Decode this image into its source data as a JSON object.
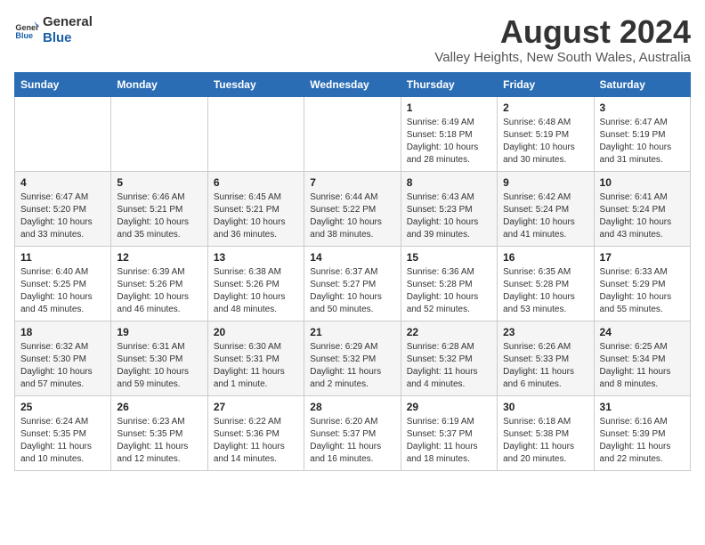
{
  "logo": {
    "line1": "General",
    "line2": "Blue"
  },
  "title": "August 2024",
  "subtitle": "Valley Heights, New South Wales, Australia",
  "days_of_week": [
    "Sunday",
    "Monday",
    "Tuesday",
    "Wednesday",
    "Thursday",
    "Friday",
    "Saturday"
  ],
  "weeks": [
    [
      {
        "num": "",
        "info": ""
      },
      {
        "num": "",
        "info": ""
      },
      {
        "num": "",
        "info": ""
      },
      {
        "num": "",
        "info": ""
      },
      {
        "num": "1",
        "info": "Sunrise: 6:49 AM\nSunset: 5:18 PM\nDaylight: 10 hours\nand 28 minutes."
      },
      {
        "num": "2",
        "info": "Sunrise: 6:48 AM\nSunset: 5:19 PM\nDaylight: 10 hours\nand 30 minutes."
      },
      {
        "num": "3",
        "info": "Sunrise: 6:47 AM\nSunset: 5:19 PM\nDaylight: 10 hours\nand 31 minutes."
      }
    ],
    [
      {
        "num": "4",
        "info": "Sunrise: 6:47 AM\nSunset: 5:20 PM\nDaylight: 10 hours\nand 33 minutes."
      },
      {
        "num": "5",
        "info": "Sunrise: 6:46 AM\nSunset: 5:21 PM\nDaylight: 10 hours\nand 35 minutes."
      },
      {
        "num": "6",
        "info": "Sunrise: 6:45 AM\nSunset: 5:21 PM\nDaylight: 10 hours\nand 36 minutes."
      },
      {
        "num": "7",
        "info": "Sunrise: 6:44 AM\nSunset: 5:22 PM\nDaylight: 10 hours\nand 38 minutes."
      },
      {
        "num": "8",
        "info": "Sunrise: 6:43 AM\nSunset: 5:23 PM\nDaylight: 10 hours\nand 39 minutes."
      },
      {
        "num": "9",
        "info": "Sunrise: 6:42 AM\nSunset: 5:24 PM\nDaylight: 10 hours\nand 41 minutes."
      },
      {
        "num": "10",
        "info": "Sunrise: 6:41 AM\nSunset: 5:24 PM\nDaylight: 10 hours\nand 43 minutes."
      }
    ],
    [
      {
        "num": "11",
        "info": "Sunrise: 6:40 AM\nSunset: 5:25 PM\nDaylight: 10 hours\nand 45 minutes."
      },
      {
        "num": "12",
        "info": "Sunrise: 6:39 AM\nSunset: 5:26 PM\nDaylight: 10 hours\nand 46 minutes."
      },
      {
        "num": "13",
        "info": "Sunrise: 6:38 AM\nSunset: 5:26 PM\nDaylight: 10 hours\nand 48 minutes."
      },
      {
        "num": "14",
        "info": "Sunrise: 6:37 AM\nSunset: 5:27 PM\nDaylight: 10 hours\nand 50 minutes."
      },
      {
        "num": "15",
        "info": "Sunrise: 6:36 AM\nSunset: 5:28 PM\nDaylight: 10 hours\nand 52 minutes."
      },
      {
        "num": "16",
        "info": "Sunrise: 6:35 AM\nSunset: 5:28 PM\nDaylight: 10 hours\nand 53 minutes."
      },
      {
        "num": "17",
        "info": "Sunrise: 6:33 AM\nSunset: 5:29 PM\nDaylight: 10 hours\nand 55 minutes."
      }
    ],
    [
      {
        "num": "18",
        "info": "Sunrise: 6:32 AM\nSunset: 5:30 PM\nDaylight: 10 hours\nand 57 minutes."
      },
      {
        "num": "19",
        "info": "Sunrise: 6:31 AM\nSunset: 5:30 PM\nDaylight: 10 hours\nand 59 minutes."
      },
      {
        "num": "20",
        "info": "Sunrise: 6:30 AM\nSunset: 5:31 PM\nDaylight: 11 hours\nand 1 minute."
      },
      {
        "num": "21",
        "info": "Sunrise: 6:29 AM\nSunset: 5:32 PM\nDaylight: 11 hours\nand 2 minutes."
      },
      {
        "num": "22",
        "info": "Sunrise: 6:28 AM\nSunset: 5:32 PM\nDaylight: 11 hours\nand 4 minutes."
      },
      {
        "num": "23",
        "info": "Sunrise: 6:26 AM\nSunset: 5:33 PM\nDaylight: 11 hours\nand 6 minutes."
      },
      {
        "num": "24",
        "info": "Sunrise: 6:25 AM\nSunset: 5:34 PM\nDaylight: 11 hours\nand 8 minutes."
      }
    ],
    [
      {
        "num": "25",
        "info": "Sunrise: 6:24 AM\nSunset: 5:35 PM\nDaylight: 11 hours\nand 10 minutes."
      },
      {
        "num": "26",
        "info": "Sunrise: 6:23 AM\nSunset: 5:35 PM\nDaylight: 11 hours\nand 12 minutes."
      },
      {
        "num": "27",
        "info": "Sunrise: 6:22 AM\nSunset: 5:36 PM\nDaylight: 11 hours\nand 14 minutes."
      },
      {
        "num": "28",
        "info": "Sunrise: 6:20 AM\nSunset: 5:37 PM\nDaylight: 11 hours\nand 16 minutes."
      },
      {
        "num": "29",
        "info": "Sunrise: 6:19 AM\nSunset: 5:37 PM\nDaylight: 11 hours\nand 18 minutes."
      },
      {
        "num": "30",
        "info": "Sunrise: 6:18 AM\nSunset: 5:38 PM\nDaylight: 11 hours\nand 20 minutes."
      },
      {
        "num": "31",
        "info": "Sunrise: 6:16 AM\nSunset: 5:39 PM\nDaylight: 11 hours\nand 22 minutes."
      }
    ]
  ]
}
